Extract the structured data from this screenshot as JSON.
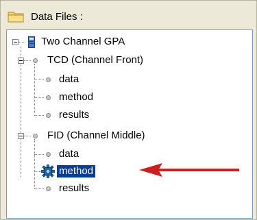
{
  "header": {
    "title": "Data Files :",
    "icon": "folder-icon"
  },
  "tree": {
    "root": {
      "label": "Two Channel GPA",
      "icon": "gc-instrument-icon"
    },
    "channels": [
      {
        "label": "TCD  (Channel Front)",
        "items": [
          {
            "label": "data"
          },
          {
            "label": "method"
          },
          {
            "label": "results"
          }
        ]
      },
      {
        "label": "FID  (Channel Middle)",
        "items": [
          {
            "label": "data"
          },
          {
            "label": "method",
            "selected": true,
            "icon": "gear-icon"
          },
          {
            "label": "results"
          }
        ]
      }
    ]
  },
  "annotation": {
    "arrow_color": "#cc1f1f",
    "icon": "red-arrow-icon"
  },
  "colors": {
    "selection": "#0a3d91",
    "panel": "#ece9d8"
  }
}
